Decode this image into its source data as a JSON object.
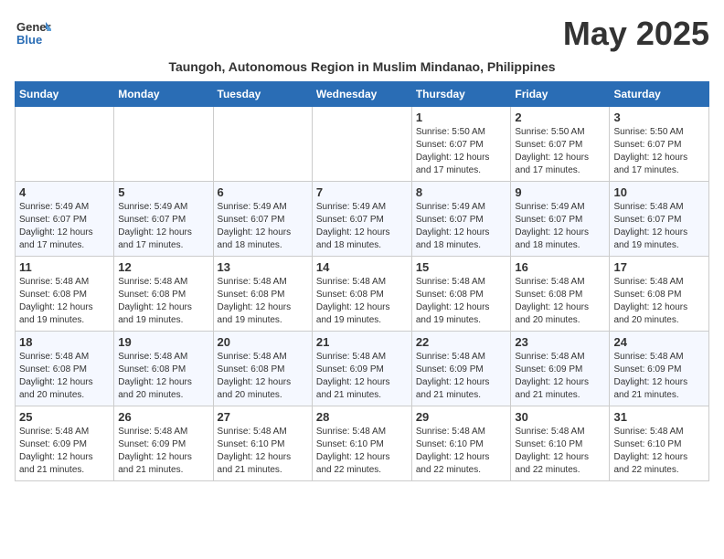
{
  "logo": {
    "general": "General",
    "blue": "Blue"
  },
  "title": "May 2025",
  "subtitle": "Taungoh, Autonomous Region in Muslim Mindanao, Philippines",
  "days_header": [
    "Sunday",
    "Monday",
    "Tuesday",
    "Wednesday",
    "Thursday",
    "Friday",
    "Saturday"
  ],
  "weeks": [
    {
      "days": [
        {
          "number": "",
          "info": ""
        },
        {
          "number": "",
          "info": ""
        },
        {
          "number": "",
          "info": ""
        },
        {
          "number": "",
          "info": ""
        },
        {
          "number": "1",
          "info": "Sunrise: 5:50 AM\nSunset: 6:07 PM\nDaylight: 12 hours\nand 17 minutes."
        },
        {
          "number": "2",
          "info": "Sunrise: 5:50 AM\nSunset: 6:07 PM\nDaylight: 12 hours\nand 17 minutes."
        },
        {
          "number": "3",
          "info": "Sunrise: 5:50 AM\nSunset: 6:07 PM\nDaylight: 12 hours\nand 17 minutes."
        }
      ]
    },
    {
      "days": [
        {
          "number": "4",
          "info": "Sunrise: 5:49 AM\nSunset: 6:07 PM\nDaylight: 12 hours\nand 17 minutes."
        },
        {
          "number": "5",
          "info": "Sunrise: 5:49 AM\nSunset: 6:07 PM\nDaylight: 12 hours\nand 17 minutes."
        },
        {
          "number": "6",
          "info": "Sunrise: 5:49 AM\nSunset: 6:07 PM\nDaylight: 12 hours\nand 18 minutes."
        },
        {
          "number": "7",
          "info": "Sunrise: 5:49 AM\nSunset: 6:07 PM\nDaylight: 12 hours\nand 18 minutes."
        },
        {
          "number": "8",
          "info": "Sunrise: 5:49 AM\nSunset: 6:07 PM\nDaylight: 12 hours\nand 18 minutes."
        },
        {
          "number": "9",
          "info": "Sunrise: 5:49 AM\nSunset: 6:07 PM\nDaylight: 12 hours\nand 18 minutes."
        },
        {
          "number": "10",
          "info": "Sunrise: 5:48 AM\nSunset: 6:07 PM\nDaylight: 12 hours\nand 19 minutes."
        }
      ]
    },
    {
      "days": [
        {
          "number": "11",
          "info": "Sunrise: 5:48 AM\nSunset: 6:08 PM\nDaylight: 12 hours\nand 19 minutes."
        },
        {
          "number": "12",
          "info": "Sunrise: 5:48 AM\nSunset: 6:08 PM\nDaylight: 12 hours\nand 19 minutes."
        },
        {
          "number": "13",
          "info": "Sunrise: 5:48 AM\nSunset: 6:08 PM\nDaylight: 12 hours\nand 19 minutes."
        },
        {
          "number": "14",
          "info": "Sunrise: 5:48 AM\nSunset: 6:08 PM\nDaylight: 12 hours\nand 19 minutes."
        },
        {
          "number": "15",
          "info": "Sunrise: 5:48 AM\nSunset: 6:08 PM\nDaylight: 12 hours\nand 19 minutes."
        },
        {
          "number": "16",
          "info": "Sunrise: 5:48 AM\nSunset: 6:08 PM\nDaylight: 12 hours\nand 20 minutes."
        },
        {
          "number": "17",
          "info": "Sunrise: 5:48 AM\nSunset: 6:08 PM\nDaylight: 12 hours\nand 20 minutes."
        }
      ]
    },
    {
      "days": [
        {
          "number": "18",
          "info": "Sunrise: 5:48 AM\nSunset: 6:08 PM\nDaylight: 12 hours\nand 20 minutes."
        },
        {
          "number": "19",
          "info": "Sunrise: 5:48 AM\nSunset: 6:08 PM\nDaylight: 12 hours\nand 20 minutes."
        },
        {
          "number": "20",
          "info": "Sunrise: 5:48 AM\nSunset: 6:08 PM\nDaylight: 12 hours\nand 20 minutes."
        },
        {
          "number": "21",
          "info": "Sunrise: 5:48 AM\nSunset: 6:09 PM\nDaylight: 12 hours\nand 21 minutes."
        },
        {
          "number": "22",
          "info": "Sunrise: 5:48 AM\nSunset: 6:09 PM\nDaylight: 12 hours\nand 21 minutes."
        },
        {
          "number": "23",
          "info": "Sunrise: 5:48 AM\nSunset: 6:09 PM\nDaylight: 12 hours\nand 21 minutes."
        },
        {
          "number": "24",
          "info": "Sunrise: 5:48 AM\nSunset: 6:09 PM\nDaylight: 12 hours\nand 21 minutes."
        }
      ]
    },
    {
      "days": [
        {
          "number": "25",
          "info": "Sunrise: 5:48 AM\nSunset: 6:09 PM\nDaylight: 12 hours\nand 21 minutes."
        },
        {
          "number": "26",
          "info": "Sunrise: 5:48 AM\nSunset: 6:09 PM\nDaylight: 12 hours\nand 21 minutes."
        },
        {
          "number": "27",
          "info": "Sunrise: 5:48 AM\nSunset: 6:10 PM\nDaylight: 12 hours\nand 21 minutes."
        },
        {
          "number": "28",
          "info": "Sunrise: 5:48 AM\nSunset: 6:10 PM\nDaylight: 12 hours\nand 22 minutes."
        },
        {
          "number": "29",
          "info": "Sunrise: 5:48 AM\nSunset: 6:10 PM\nDaylight: 12 hours\nand 22 minutes."
        },
        {
          "number": "30",
          "info": "Sunrise: 5:48 AM\nSunset: 6:10 PM\nDaylight: 12 hours\nand 22 minutes."
        },
        {
          "number": "31",
          "info": "Sunrise: 5:48 AM\nSunset: 6:10 PM\nDaylight: 12 hours\nand 22 minutes."
        }
      ]
    }
  ]
}
